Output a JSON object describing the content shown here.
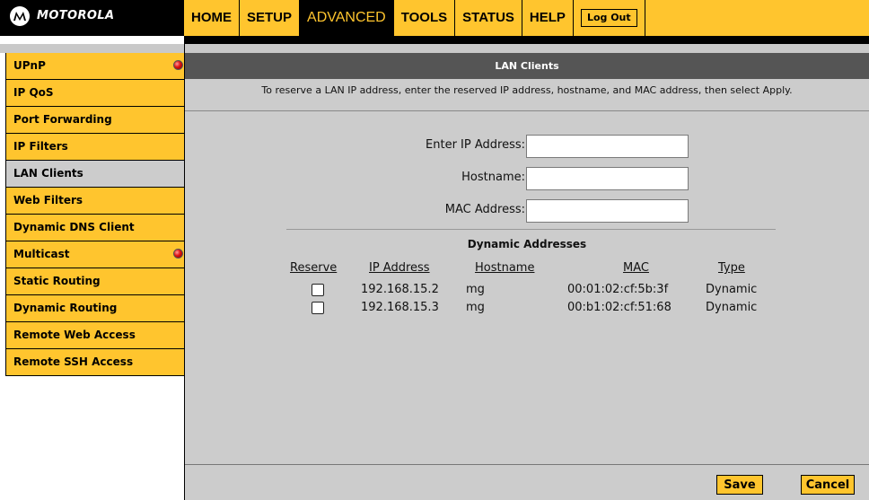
{
  "brand": {
    "name": "MOTOROLA",
    "logo_icon": "motorola-batwing-icon"
  },
  "topnav": {
    "items": [
      {
        "label": "HOME",
        "active": false
      },
      {
        "label": "SETUP",
        "active": false
      },
      {
        "label": "ADVANCED",
        "active": true
      },
      {
        "label": "TOOLS",
        "active": false
      },
      {
        "label": "STATUS",
        "active": false
      },
      {
        "label": "HELP",
        "active": false
      }
    ],
    "logout_label": "Log Out"
  },
  "sidebar": {
    "items": [
      {
        "label": "UPnP",
        "alert": true
      },
      {
        "label": "IP QoS",
        "alert": false
      },
      {
        "label": "Port Forwarding",
        "alert": false
      },
      {
        "label": "IP Filters",
        "alert": false
      },
      {
        "label": "LAN Clients",
        "alert": false,
        "active": true
      },
      {
        "label": "Web Filters",
        "alert": false
      },
      {
        "label": "Dynamic DNS Client",
        "alert": false
      },
      {
        "label": "Multicast",
        "alert": true
      },
      {
        "label": "Static Routing",
        "alert": false
      },
      {
        "label": "Dynamic Routing",
        "alert": false
      },
      {
        "label": "Remote Web Access",
        "alert": false
      },
      {
        "label": "Remote SSH Access",
        "alert": false
      }
    ]
  },
  "main": {
    "title": "LAN Clients",
    "instruction": "To reserve a LAN IP address, enter the reserved IP address, hostname, and MAC address, then select Apply.",
    "form": {
      "ip_label": "Enter IP Address:",
      "ip_value": "",
      "hostname_label": "Hostname:",
      "hostname_value": "",
      "mac_label": "MAC Address:",
      "mac_value": ""
    },
    "dynamic": {
      "title": "Dynamic Addresses",
      "columns": [
        "Reserve",
        "IP Address",
        "Hostname",
        "MAC",
        "Type"
      ],
      "rows": [
        {
          "reserve": false,
          "ip": "192.168.15.2",
          "hostname": "mg",
          "mac": "00:01:02:cf:5b:3f",
          "type": "Dynamic"
        },
        {
          "reserve": false,
          "ip": "192.168.15.3",
          "hostname": "mg",
          "mac": "00:b1:02:cf:51:68",
          "type": "Dynamic"
        }
      ]
    },
    "save_label": "Save",
    "cancel_label": "Cancel"
  },
  "colors": {
    "accent": "#ffc52e",
    "header_bg": "#555555",
    "panel_bg": "#cccccc",
    "alert": "#e01010"
  }
}
